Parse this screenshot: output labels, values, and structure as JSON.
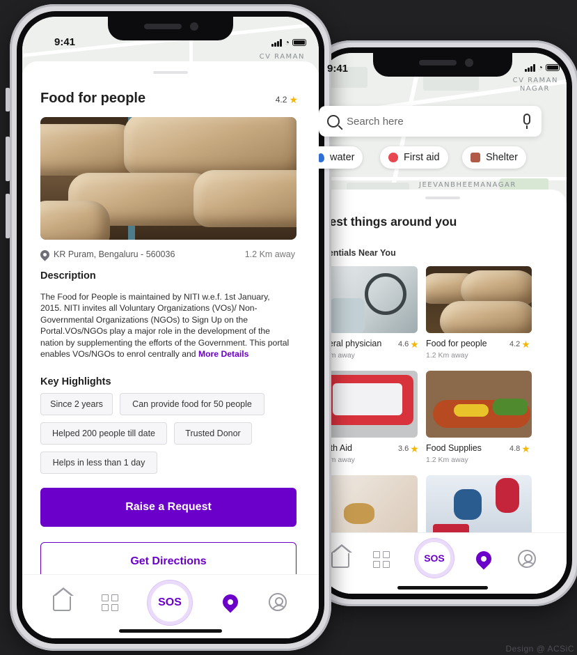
{
  "left_phone": {
    "status_time": "9:41",
    "map_label": "CV RAMAN",
    "title": "Food for people",
    "rating": "4.2",
    "location": "KR Puram, Bengaluru - 560036",
    "distance": "1.2 Km away",
    "description_heading": "Description",
    "description_text": "The Food for People is maintained by NITI w.e.f. 1st January, 2015. NITI invites all Voluntary Organizations (VOs)/ Non-Governmental Organizations (NGOs) to Sign Up on the Portal.VOs/NGOs play a major role in the development of the nation by supplementing the efforts of the Government. This portal enables VOs/NGOs to enrol centrally and",
    "more_details": "More Details",
    "highlights_heading": "Key Highlights",
    "highlights": [
      "Since 2 years",
      "Can provide food for 50 people",
      "Helped 200 people till date",
      "Trusted Donor",
      "Helps in less than 1 day"
    ],
    "raise_request": "Raise a Request",
    "get_directions": "Get Directions",
    "nav_sos": "SOS"
  },
  "right_phone": {
    "status_time": "9:41",
    "map_label_top": "CV RAMAN",
    "map_label_top2": "NAGAR",
    "map_label_mid": "JEEVANBHEEMANAGAR",
    "search_placeholder": "Search here",
    "filters": [
      "water",
      "First aid",
      "Shelter"
    ],
    "section_title": "atest things around you",
    "subsection_title": "ssentials Near You",
    "cards": [
      {
        "name": "eneral physician",
        "rating": "4.6",
        "distance": "1 Km away"
      },
      {
        "name": "Food for people",
        "rating": "4.2",
        "distance": "1.2 Km away"
      },
      {
        "name": "ealth Aid",
        "rating": "3.6",
        "distance": "1 Km away"
      },
      {
        "name": "Food Supplies",
        "rating": "4.8",
        "distance": "1.2 Km away"
      }
    ],
    "nav_sos": "SOS"
  },
  "credit": "Design @ ACSiC",
  "colors": {
    "accent": "#6a00c9",
    "star": "#f5b700",
    "background": "#212124"
  }
}
